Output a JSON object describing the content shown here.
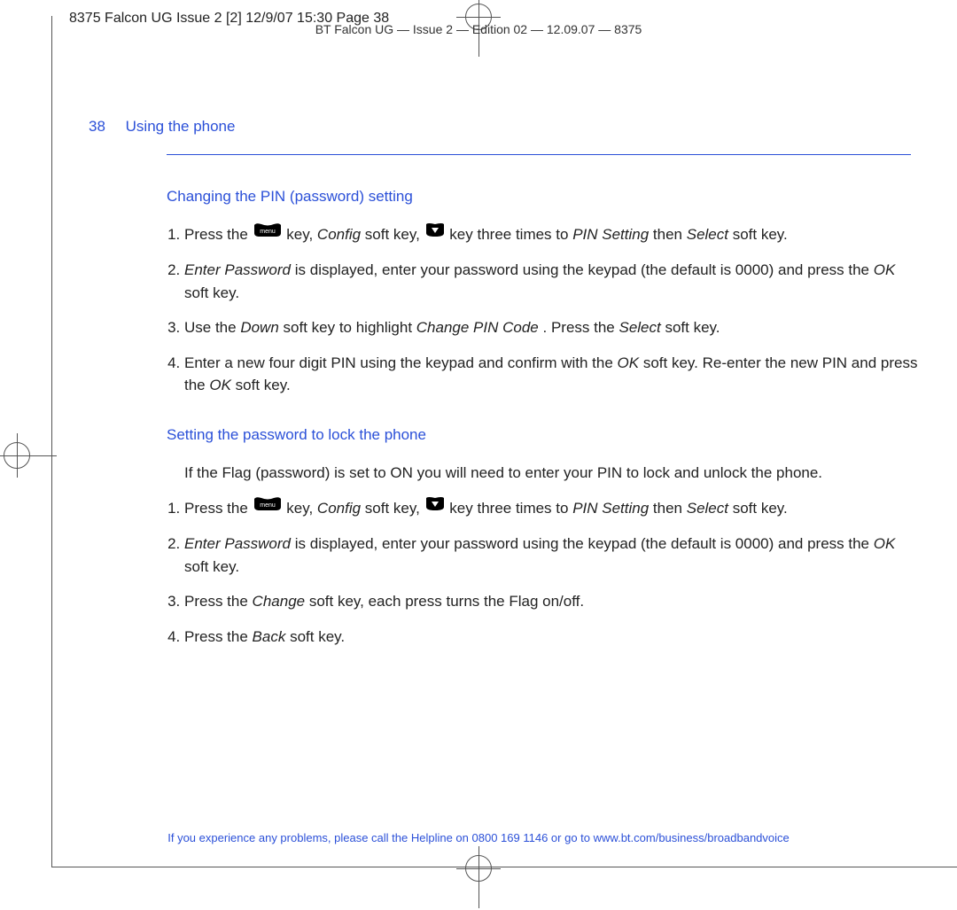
{
  "slug": "8375 Falcon UG Issue 2 [2]  12/9/07  15:30  Page 38",
  "top_header": "BT Falcon UG — Issue 2 — Edition 02 — 12.09.07 — 8375",
  "page_number": "38",
  "running_head": "Using the phone",
  "section1_title": "Changing the PIN (password) setting",
  "s1l1_a": "Press the ",
  "s1l1_b": " key, ",
  "s1l1_config": "Config",
  "s1l1_c": " soft key, ",
  "s1l1_d": " key three times to ",
  "s1l1_pin": "PIN Setting",
  "s1l1_e": " then ",
  "s1l1_select": "Select",
  "s1l1_f": " soft key.",
  "s1l2_ep": "Enter Password",
  "s1l2_a": " is displayed, enter your password using the keypad (the default is 0000) and press the ",
  "s1l2_ok": "OK",
  "s1l2_b": " soft key.",
  "s1l3_a": "Use the ",
  "s1l3_down": "Down",
  "s1l3_b": " soft key to highlight ",
  "s1l3_cpc": "Change PIN Code",
  "s1l3_c": ". Press the ",
  "s1l3_select": "Select",
  "s1l3_d": " soft key.",
  "s1l4_a": "Enter a new four digit PIN using the keypad and confirm with the ",
  "s1l4_ok1": "OK",
  "s1l4_b": " soft key. Re-enter the new PIN and press the ",
  "s1l4_ok2": "OK",
  "s1l4_c": " soft key.",
  "section2_title": "Setting the password to lock the phone",
  "section2_intro": "If the Flag (password) is set to ON you will need to enter your PIN to lock and unlock the phone.",
  "s2l1_a": "Press the ",
  "s2l1_b": " key, ",
  "s2l1_config": "Config",
  "s2l1_c": " soft key, ",
  "s2l1_d": " key three times to ",
  "s2l1_pin": "PIN Setting",
  "s2l1_e": " then ",
  "s2l1_select": "Select",
  "s2l1_f": " soft key.",
  "s2l2_ep": "Enter Password",
  "s2l2_a": " is displayed, enter your password using the keypad (the default is 0000) and press the ",
  "s2l2_ok": "OK",
  "s2l2_b": " soft key.",
  "s2l3_a": "Press the ",
  "s2l3_change": "Change",
  "s2l3_b": " soft key, each press turns the Flag on/off.",
  "s2l4_a": "Press the ",
  "s2l4_back": "Back",
  "s2l4_b": " soft key.",
  "helpline_a": "If you experience any problems, please call the Helpline on ",
  "helpline_num": "0800 169 1146",
  "helpline_b": " or go to ",
  "helpline_url": "www.bt.com/business/broadbandvoice"
}
